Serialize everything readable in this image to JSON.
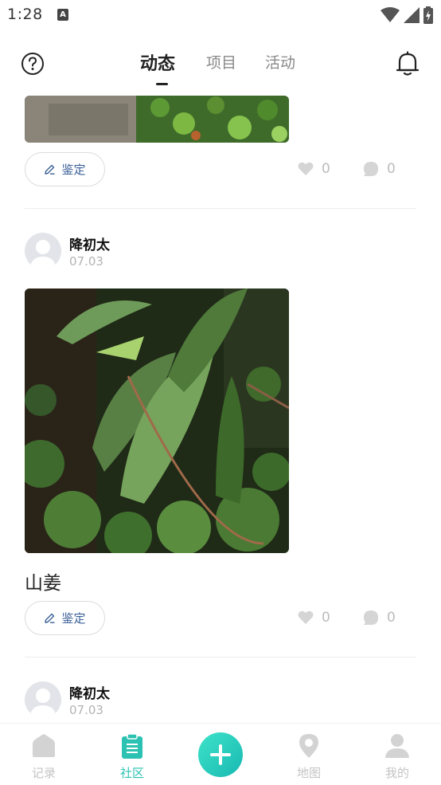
{
  "status_bar": {
    "time": "1:28",
    "notification_glyph": "A"
  },
  "header": {
    "tabs": [
      {
        "label": "动态",
        "active": true
      },
      {
        "label": "项目",
        "active": false
      },
      {
        "label": "活动",
        "active": false
      }
    ]
  },
  "posts": [
    {
      "identify_label": "鉴定",
      "likes": "0",
      "comments": "0"
    },
    {
      "username": "降初太",
      "date": "07.03",
      "title": "山姜",
      "identify_label": "鉴定",
      "likes": "0",
      "comments": "0"
    },
    {
      "username": "降初太",
      "date": "07.03"
    }
  ],
  "bottom_nav": {
    "items": [
      {
        "label": "记录",
        "icon": "home-icon",
        "active": false
      },
      {
        "label": "社区",
        "icon": "clipboard-icon",
        "active": true
      },
      {
        "label": "地图",
        "icon": "map-pin-icon",
        "active": false
      },
      {
        "label": "我的",
        "icon": "person-icon",
        "active": false
      }
    ],
    "fab_icon": "plus-icon"
  },
  "colors": {
    "accent": "#2cc2b3",
    "link": "#3a5f97",
    "muted": "#bbbbbb"
  }
}
